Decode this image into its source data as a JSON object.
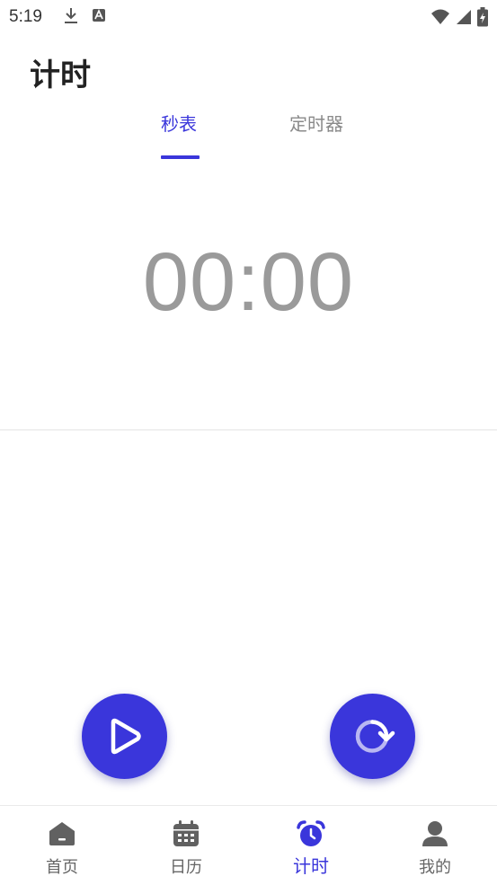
{
  "status_bar": {
    "time": "5:19",
    "icons": [
      "download-icon",
      "font-a-icon",
      "wifi-icon",
      "cellular-signal-icon",
      "battery-charging-icon"
    ]
  },
  "header": {
    "title": "计时"
  },
  "tabs": [
    {
      "label": "秒表",
      "active": true
    },
    {
      "label": "定时器",
      "active": false
    }
  ],
  "stopwatch": {
    "display": "00:00"
  },
  "controls": {
    "play_icon": "play-icon",
    "reset_icon": "reset-icon"
  },
  "bottom_nav": {
    "items": [
      {
        "label": "首页",
        "icon": "home-icon",
        "active": false
      },
      {
        "label": "日历",
        "icon": "calendar-icon",
        "active": false
      },
      {
        "label": "计时",
        "icon": "alarm-clock-icon",
        "active": true
      },
      {
        "label": "我的",
        "icon": "person-icon",
        "active": false
      }
    ]
  },
  "colors": {
    "accent": "#3a36db",
    "time_text": "#9a9a9a",
    "inactive_text": "#8a8a8a",
    "nav_icon": "#616161"
  }
}
